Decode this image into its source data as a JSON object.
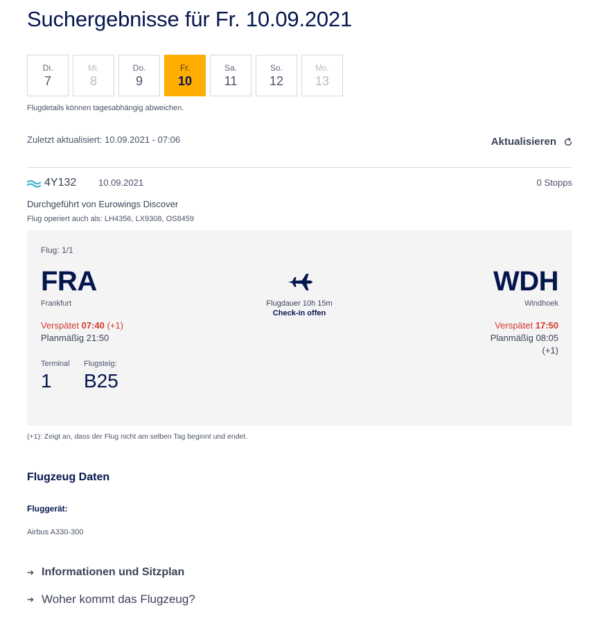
{
  "page": {
    "title": "Suchergebnisse für  Fr. 10.09.2021"
  },
  "days": [
    {
      "dow": "Di.",
      "num": "7",
      "state": "normal"
    },
    {
      "dow": "Mi.",
      "num": "8",
      "state": "disabled"
    },
    {
      "dow": "Do.",
      "num": "9",
      "state": "normal"
    },
    {
      "dow": "Fr.",
      "num": "10",
      "state": "active"
    },
    {
      "dow": "Sa.",
      "num": "11",
      "state": "normal"
    },
    {
      "dow": "So.",
      "num": "12",
      "state": "normal"
    },
    {
      "dow": "Mo.",
      "num": "13",
      "state": "disabled"
    }
  ],
  "notes": {
    "day_hint": "Flugdetails können tagesabhängig abweichen.",
    "last_updated": "Zuletzt aktualisiert: 10.09.2021 - 07:06",
    "refresh_label": "Aktualisieren"
  },
  "flight": {
    "number": "4Y132",
    "date": "10.09.2021",
    "stops": "0 Stopps",
    "operated_by": "Durchgeführt von Eurowings Discover",
    "codeshare": "Flug operiert auch als: LH4356, LX9308, OS8459",
    "segment_label": "Flug: 1/1",
    "departure": {
      "iata": "FRA",
      "city": "Frankfurt",
      "delay_prefix": "Verspätet",
      "delay_time": "07:40",
      "delay_suffix": "(+1)",
      "planned": "Planmäßig 21:50",
      "terminal_label": "Terminal",
      "terminal": "1",
      "gate_label": "Flugsteig:",
      "gate": "B25"
    },
    "duration": "Flugdauer 10h 15m",
    "checkin": "Check-in offen",
    "arrival": {
      "iata": "WDH",
      "city": "Windhoek",
      "delay_prefix": "Verspätet",
      "delay_time": "17:50",
      "planned": "Planmäßig 08:05",
      "plus_one": "(+1)"
    },
    "legend": "(+1): Zeigt an, dass der Flug nicht am selben Tag beginnt und endet."
  },
  "aircraft": {
    "section_title": "Flugzeug Daten",
    "label": "Fluggerät:",
    "value": "Airbus A330-300"
  },
  "links": {
    "info_seatmap": "Informationen und Sitzplan",
    "origin": "Woher kommt das Flugzeug?"
  },
  "colors": {
    "brand_navy": "#05164d",
    "active_day": "#ffad00",
    "delay_red": "#d33a2c",
    "card_bg": "#f4f4f5",
    "airline_logo": "#3cb4c8"
  }
}
